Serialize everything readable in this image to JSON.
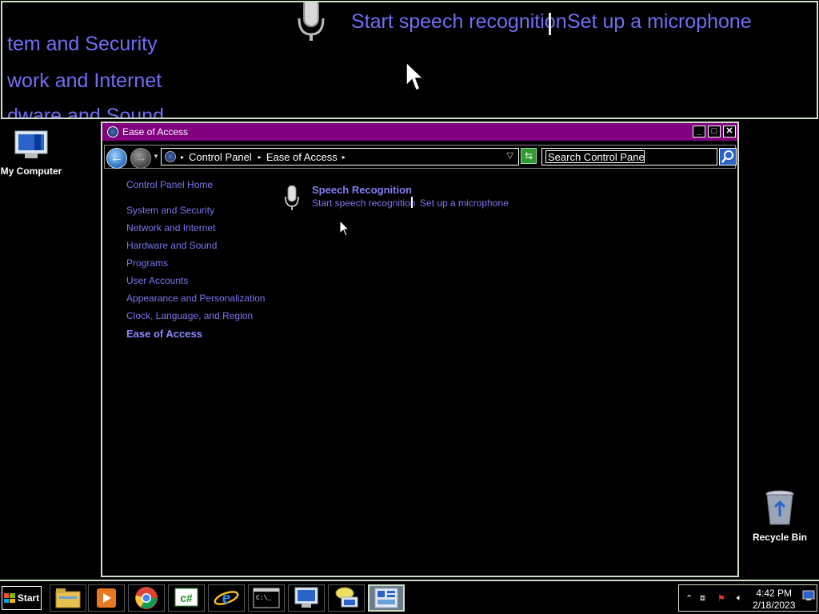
{
  "magnifier": {
    "link_start": "Start speech recognition",
    "link_setup": "Set up a microphone",
    "nav_1": "tem and Security",
    "nav_2": "work and Internet",
    "nav_3": "dware and Sound"
  },
  "desktop": {
    "my_computer": "My Computer",
    "recycle_bin": "Recycle Bin"
  },
  "window": {
    "title": "Ease of Access",
    "breadcrumb": [
      "Control Panel",
      "Ease of Access"
    ],
    "search_placeholder": "Search Control Panel"
  },
  "leftnav": {
    "home": "Control Panel Home",
    "items": [
      "System and Security",
      "Network and Internet",
      "Hardware and Sound",
      "Programs",
      "User Accounts",
      "Appearance and Personalization",
      "Clock, Language, and Region"
    ],
    "active": "Ease of Access"
  },
  "content": {
    "category_title": "Speech Recognition",
    "link_start": "Start speech recognition",
    "link_setup": "Set up a microphone"
  },
  "taskbar": {
    "start_label": "Start",
    "apps": [
      "file-explorer-icon",
      "media-player-icon",
      "chrome-icon",
      "csharp-icon",
      "internet-explorer-icon",
      "command-prompt-icon",
      "my-computer-icon",
      "network-chat-icon",
      "control-panel-icon"
    ],
    "time": "4:42 PM",
    "date": "2/18/2023"
  },
  "colors": {
    "titlebar": "#800080",
    "link": "#7878ef",
    "border": "#cfe0c8"
  }
}
